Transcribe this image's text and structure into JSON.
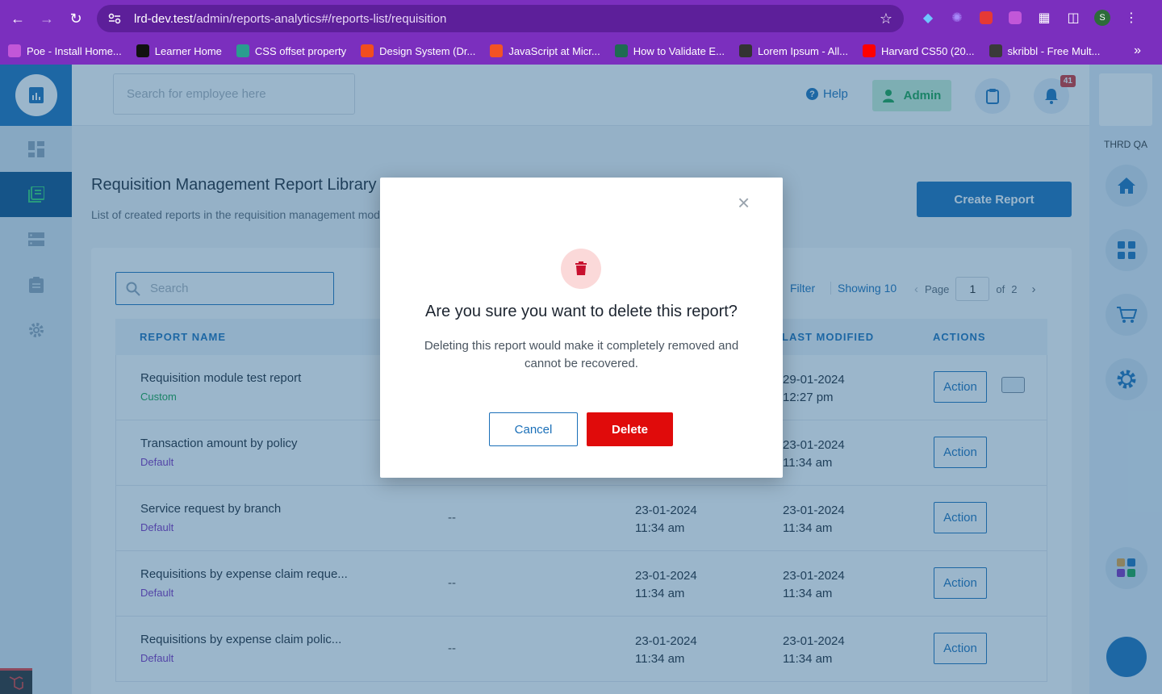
{
  "browser": {
    "url_host": "lrd-dev.test",
    "url_path": "/admin/reports-analytics#/reports-list/requisition",
    "profile_initial": "S",
    "bookmarks": [
      {
        "label": "Poe - Install Home...",
        "color": "#c257d8"
      },
      {
        "label": "Learner Home",
        "color": "#111111"
      },
      {
        "label": "CSS offset property",
        "color": "#2a9d8f"
      },
      {
        "label": "Design System (Dr...",
        "color": "#f24e1e"
      },
      {
        "label": "JavaScript at Micr...",
        "color": "#f35325"
      },
      {
        "label": "How to Validate E...",
        "color": "#1e6b52"
      },
      {
        "label": "Lorem Ipsum - All...",
        "color": "#333333"
      },
      {
        "label": "Harvard CS50 (20...",
        "color": "#ff0000"
      },
      {
        "label": "skribbl - Free Mult...",
        "color": "#3a3a3a"
      }
    ]
  },
  "header": {
    "search_placeholder": "Search for employee here",
    "help_label": "Help",
    "admin_label": "Admin",
    "notification_count": "41"
  },
  "right_rail": {
    "label": "THRD QA"
  },
  "page": {
    "title": "Requisition Management Report Library",
    "subtitle": "List of created reports in the requisition management module",
    "create_button": "Create Report"
  },
  "table": {
    "search_placeholder": "Search",
    "filter_label": "Filter",
    "showing_label": "Showing 10",
    "page_label": "Page",
    "page_value": "1",
    "page_of": "of",
    "page_total": "2",
    "columns": {
      "name": "REPORT NAME",
      "last_modified": "LAST MODIFIED",
      "actions": "ACTIONS"
    },
    "rows": [
      {
        "name": "Requisition module test report",
        "type": "Custom",
        "created_by": "",
        "created_date": "",
        "created_time": "",
        "modified_date": "29-01-2024",
        "modified_time": "12:27 pm",
        "action": "Action"
      },
      {
        "name": "Transaction amount by policy",
        "type": "Default",
        "created_by": "",
        "created_date": "",
        "created_time": "",
        "modified_date": "23-01-2024",
        "modified_time": "11:34 am",
        "action": "Action"
      },
      {
        "name": "Service request by branch",
        "type": "Default",
        "created_by": "--",
        "created_date": "23-01-2024",
        "created_time": "11:34 am",
        "modified_date": "23-01-2024",
        "modified_time": "11:34 am",
        "action": "Action"
      },
      {
        "name": "Requisitions by expense claim reque...",
        "type": "Default",
        "created_by": "--",
        "created_date": "23-01-2024",
        "created_time": "11:34 am",
        "modified_date": "23-01-2024",
        "modified_time": "11:34 am",
        "action": "Action"
      },
      {
        "name": "Requisitions by expense claim polic...",
        "type": "Default",
        "created_by": "--",
        "created_date": "23-01-2024",
        "created_time": "11:34 am",
        "modified_date": "23-01-2024",
        "modified_time": "11:34 am",
        "action": "Action"
      }
    ]
  },
  "modal": {
    "title": "Are you sure you want to delete this report?",
    "body": "Deleting this report would make it completely removed and cannot be recovered.",
    "cancel_label": "Cancel",
    "delete_label": "Delete"
  },
  "colors": {
    "brand": "#1a6fb8",
    "danger": "#e00b0b",
    "browser": "#7b2fbe"
  }
}
